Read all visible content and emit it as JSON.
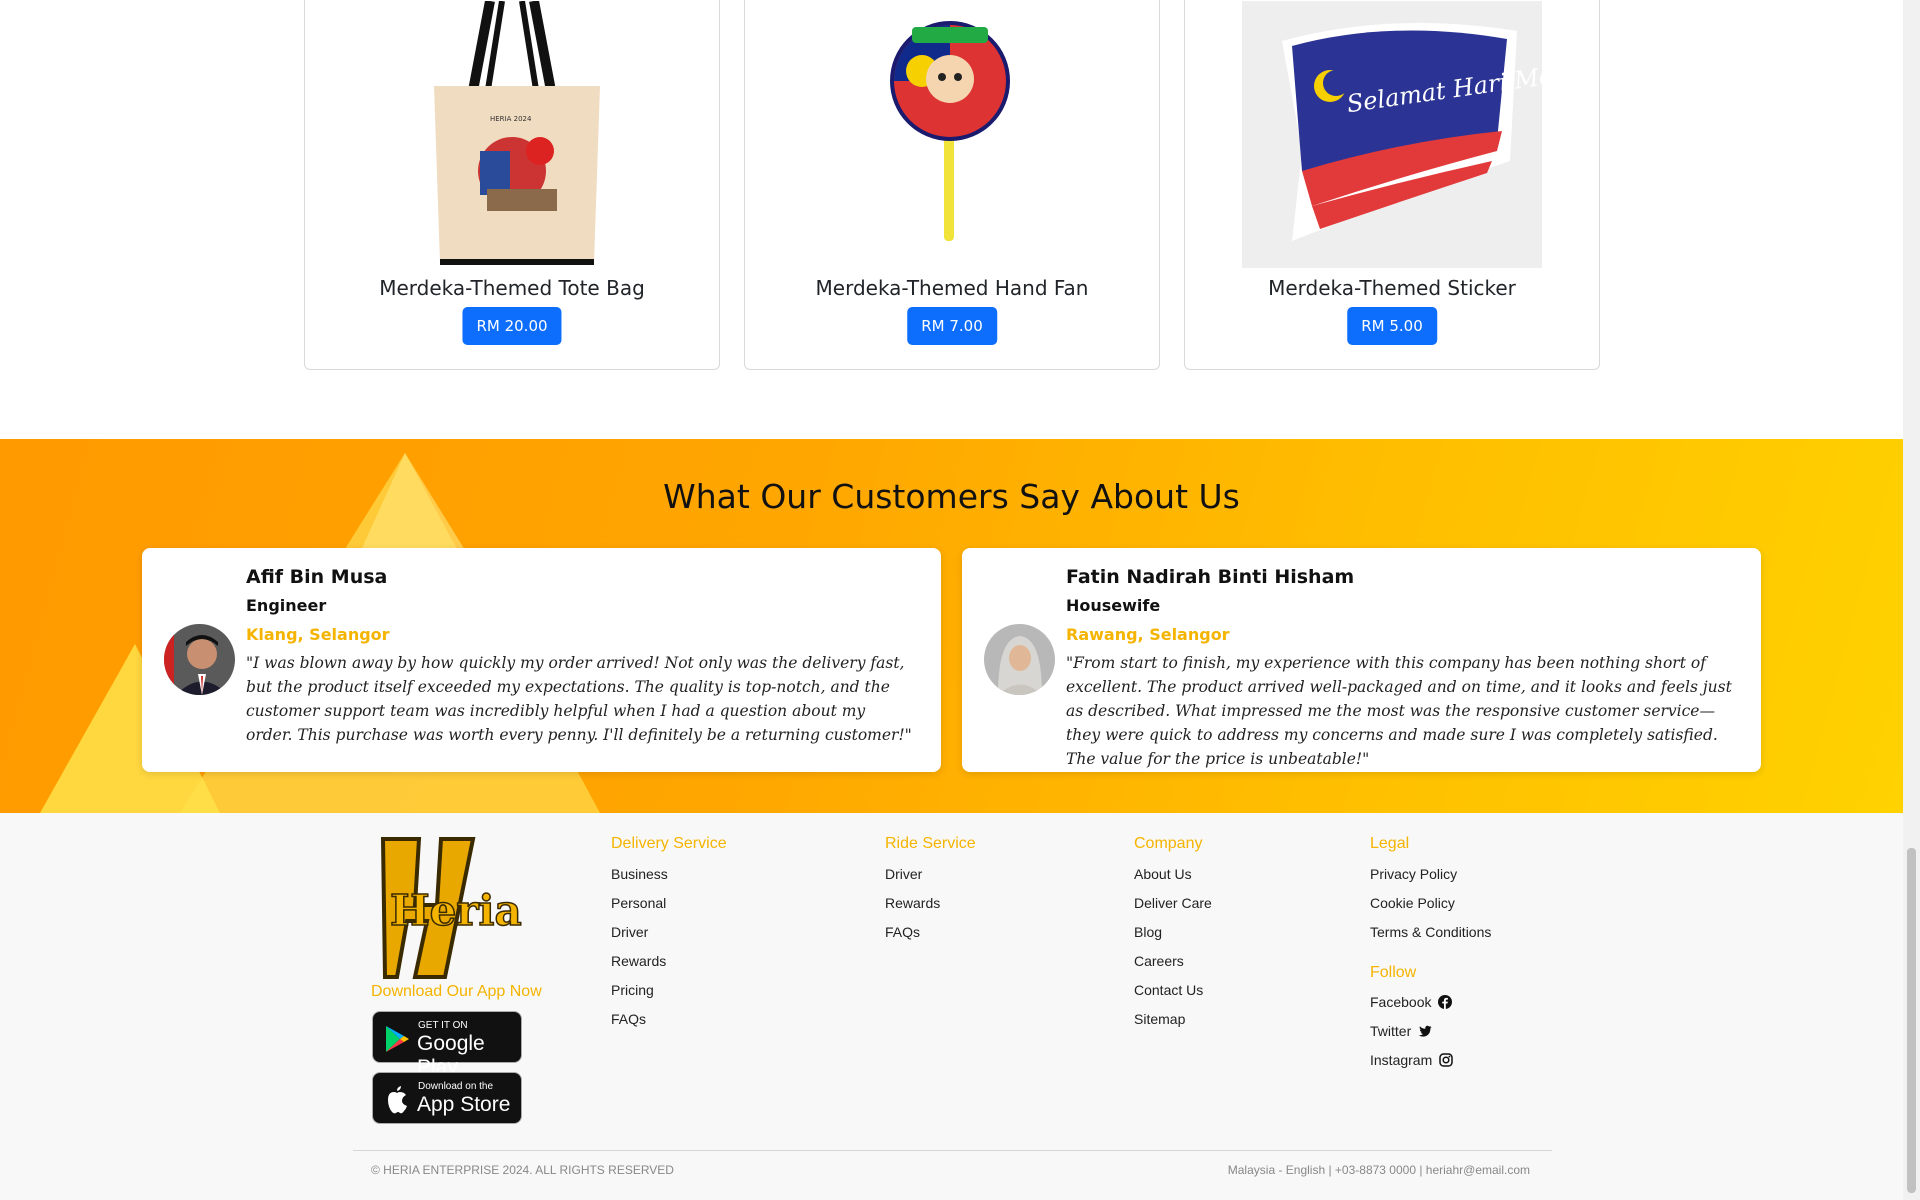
{
  "products": [
    {
      "name": "Merdeka-Themed Tote Bag",
      "price": "RM 20.00",
      "image": "tote-bag"
    },
    {
      "name": "Merdeka-Themed Hand Fan",
      "price": "RM 7.00",
      "image": "hand-fan"
    },
    {
      "name": "Merdeka-Themed Sticker",
      "price": "RM 5.00",
      "image": "sticker",
      "image_text": "Selamat Hari Merdeka"
    }
  ],
  "testimonials": {
    "title": "What Our Customers Say About Us",
    "items": [
      {
        "name": "Afif Bin Musa",
        "role": "Engineer",
        "location": "Klang, Selangor",
        "quote": "\"I was blown away by how quickly my order arrived! Not only was the delivery fast, but the product itself exceeded my expectations. The quality is top-notch, and the customer support team was incredibly helpful when I had a question about my order. This purchase was worth every penny. I'll definitely be a returning customer!\""
      },
      {
        "name": "Fatin Nadirah Binti Hisham",
        "role": "Housewife",
        "location": "Rawang, Selangor",
        "quote": "\"From start to finish, my experience with this company has been nothing short of excellent. The product arrived well-packaged and on time, and it looks and feels just as described. What impressed me the most was the responsive customer service—they were quick to address my concerns and made sure I was completely satisfied. The value for the price is unbeatable!\""
      }
    ]
  },
  "footer": {
    "logo_text": "Heria",
    "download_title": "Download Our App Now",
    "google_play": {
      "small": "GET IT ON",
      "big": "Google Play"
    },
    "app_store": {
      "small": "Download on the",
      "big": "App Store"
    },
    "columns": [
      {
        "title": "Delivery Service",
        "links": [
          "Business",
          "Personal",
          "Driver",
          "Rewards",
          "Pricing",
          "FAQs"
        ]
      },
      {
        "title": "Ride Service",
        "links": [
          "Driver",
          "Rewards",
          "FAQs"
        ]
      },
      {
        "title": "Company",
        "links": [
          "About Us",
          "Deliver Care",
          "Blog",
          "Careers",
          "Contact Us",
          "Sitemap"
        ]
      },
      {
        "title": "Legal",
        "links": [
          "Privacy Policy",
          "Cookie Policy",
          "Terms & Conditions"
        ]
      }
    ],
    "follow": {
      "title": "Follow",
      "links": [
        "Facebook",
        "Twitter",
        "Instagram"
      ]
    },
    "copyright": "© HERIA ENTERPRISE 2024. ALL RIGHTS RESERVED",
    "contact": "Malaysia - English | +03-8873 0000 | heriahr@email.com"
  },
  "colors": {
    "accent": "#f5b400",
    "price_button": "#0d6efd",
    "testimonial_bg_start": "#ff9a00",
    "testimonial_bg_end": "#ffd200"
  }
}
